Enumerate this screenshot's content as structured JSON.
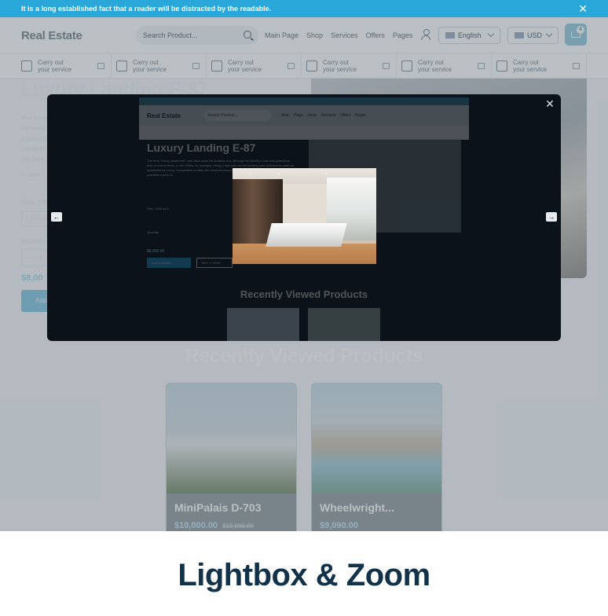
{
  "announcement": {
    "text": "It is a long established fact that a reader will be distracted by the readable.",
    "close": "✕"
  },
  "header": {
    "logo": "Real Estate",
    "search_placeholder": "Search Product...",
    "nav": [
      "Main Page",
      "Shop",
      "Services",
      "Offers",
      "Pages"
    ],
    "language": "English",
    "currency": "USD",
    "cart_count": "4"
  },
  "services": [
    {
      "line1": "Carry out",
      "line2": "your service"
    },
    {
      "line1": "Carry out",
      "line2": "your service"
    },
    {
      "line1": "Carry out",
      "line2": "your service"
    },
    {
      "line1": "Carry out",
      "line2": "your service"
    },
    {
      "line1": "Carry out",
      "line2": "your service"
    },
    {
      "line1": "Carry out",
      "line2": "your service"
    }
  ],
  "product": {
    "title": "Luxury Landing E-87",
    "description_lines": [
      "The term",
      "definitio",
      "a doorm",
      "Compet",
      "the Inte"
    ],
    "feature_link": "See",
    "size_label": "Size: 130",
    "size_option": "1300 sq",
    "quantity_label": "Quantity",
    "quantity_value": "—   1",
    "price": "$8,00",
    "add_button": "Add"
  },
  "recently_viewed": {
    "heading": "Recently Viewed Products",
    "cards": [
      {
        "name": "MiniPalais D-703",
        "price": "$10,000.00",
        "old_price": "$15,000.00"
      },
      {
        "name": "Wheelwright...",
        "price": "$9,090.00",
        "old_price": ""
      }
    ]
  },
  "lightbox": {
    "close": "✕",
    "prev": "←",
    "next": "→",
    "mini_page": {
      "logo": "Real Estate",
      "search": "Search Product...",
      "nav": "Main Page Shop Services Offers Pages",
      "title": "Luxury Landing E-87",
      "description": "The term \"luxury apartment\" was used since the postwar era, although its definition was less grandiose than in recent times. In the 1960s, for example, being a doorman for the building was sufficient to mark an apartment as luxury. Competition to state the most luxurious apartment on the internet, which allowed potential buyers to",
      "size": "Size: 1300 sq ft",
      "quantity": "Quantity",
      "price": "$8,000.00",
      "add": "Add to Basket",
      "buy": "BUY IT NOW",
      "recently_viewed": "Recently Viewed Products"
    }
  },
  "caption": "Lightbox & Zoom",
  "colors": {
    "accent": "#2aa7d9",
    "overlay": "#0b1219",
    "caption_text": "#12324a"
  }
}
